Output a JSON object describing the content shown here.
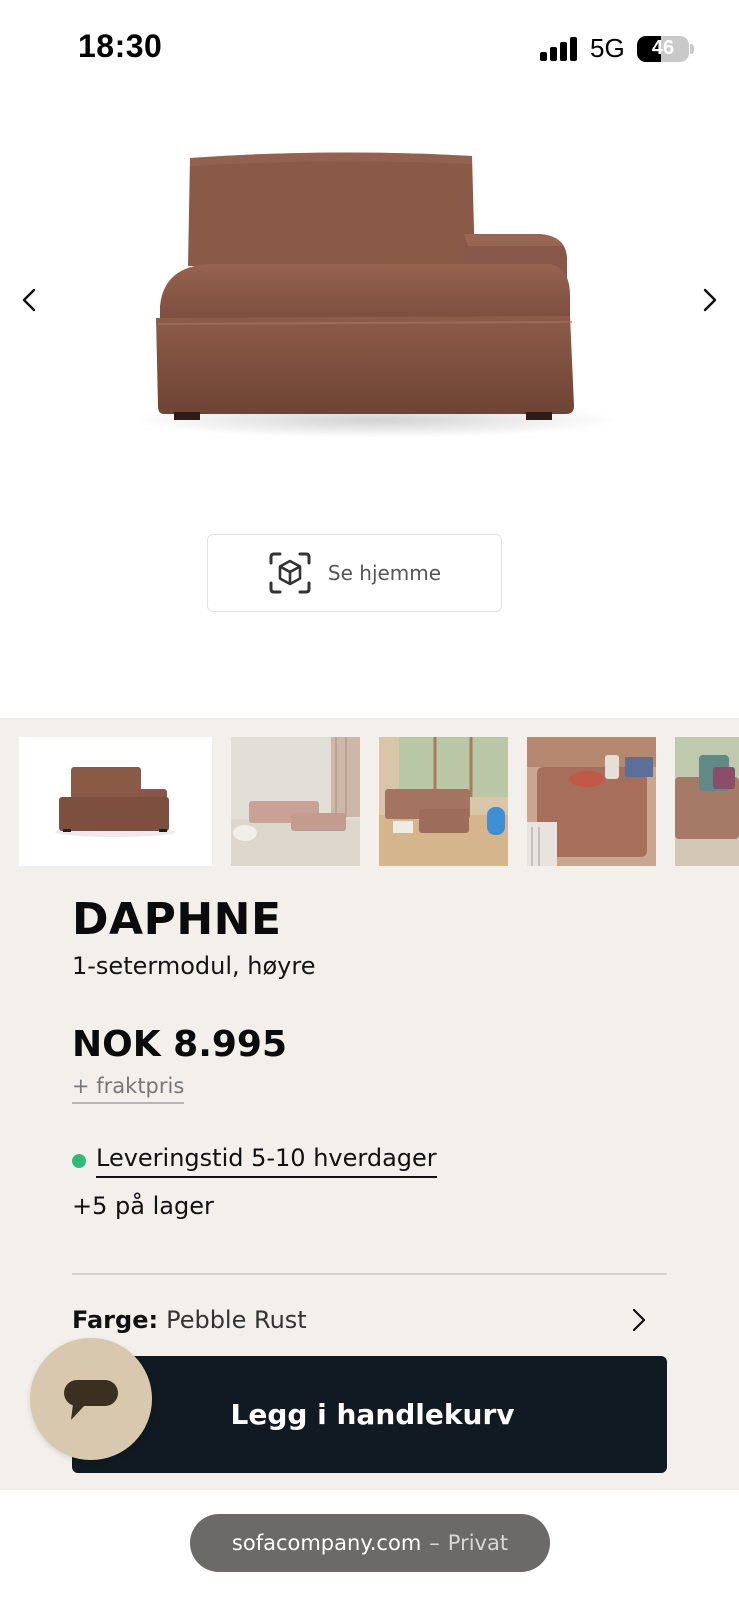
{
  "status_bar": {
    "time": "18:30",
    "network": "5G",
    "battery_percent": "46"
  },
  "hero": {
    "prev_icon": "chevron-left-icon",
    "next_icon": "chevron-right-icon",
    "ar_button_label": "Se hjemme",
    "ar_icon": "ar-cube-icon"
  },
  "gallery": {
    "thumbnails": [
      {
        "name": "thumbnail-product-white"
      },
      {
        "name": "thumbnail-room-concrete"
      },
      {
        "name": "thumbnail-room-window"
      },
      {
        "name": "thumbnail-ottoman-closeup"
      },
      {
        "name": "thumbnail-room-partial"
      }
    ],
    "selected_index": 0
  },
  "product": {
    "name": "DAPHNE",
    "variant": "1-setermodul, høyre",
    "price": "NOK 8.995",
    "freight_link": "+ fraktpris",
    "delivery_text": "Leveringstid 5-10 hverdager",
    "delivery_status_color": "#2dbb7a",
    "stock_text": "+5 på lager",
    "color_label": "Farge:",
    "color_value": "Pebble Rust",
    "add_to_cart_label": "Legg i handlekurv"
  },
  "chat": {
    "icon": "chat-bubble-icon"
  },
  "browser": {
    "host": "sofacompany.com",
    "separator": "–",
    "mode": "Privat"
  },
  "colors": {
    "sofa": "#8a5a48",
    "cart_button": "#111a22",
    "panel_bg": "#f3f0ec",
    "chat_bg": "#d8c9ae"
  }
}
